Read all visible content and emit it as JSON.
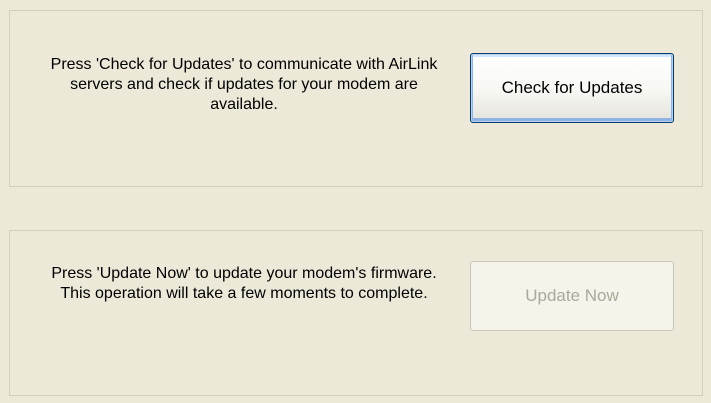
{
  "check_section": {
    "description": "Press 'Check for Updates' to communicate with AirLink servers and check if updates for your modem are available.",
    "button_label": "Check for Updates"
  },
  "update_section": {
    "description": "Press 'Update Now' to update your modem's firmware. This operation will take a few moments to complete.",
    "button_label": "Update Now",
    "button_enabled": false
  },
  "colors": {
    "window_background": "#ece9d8",
    "default_button_border": "#003c74",
    "focus_highlight": "#8fb3e4",
    "disabled_text": "#aca899"
  }
}
